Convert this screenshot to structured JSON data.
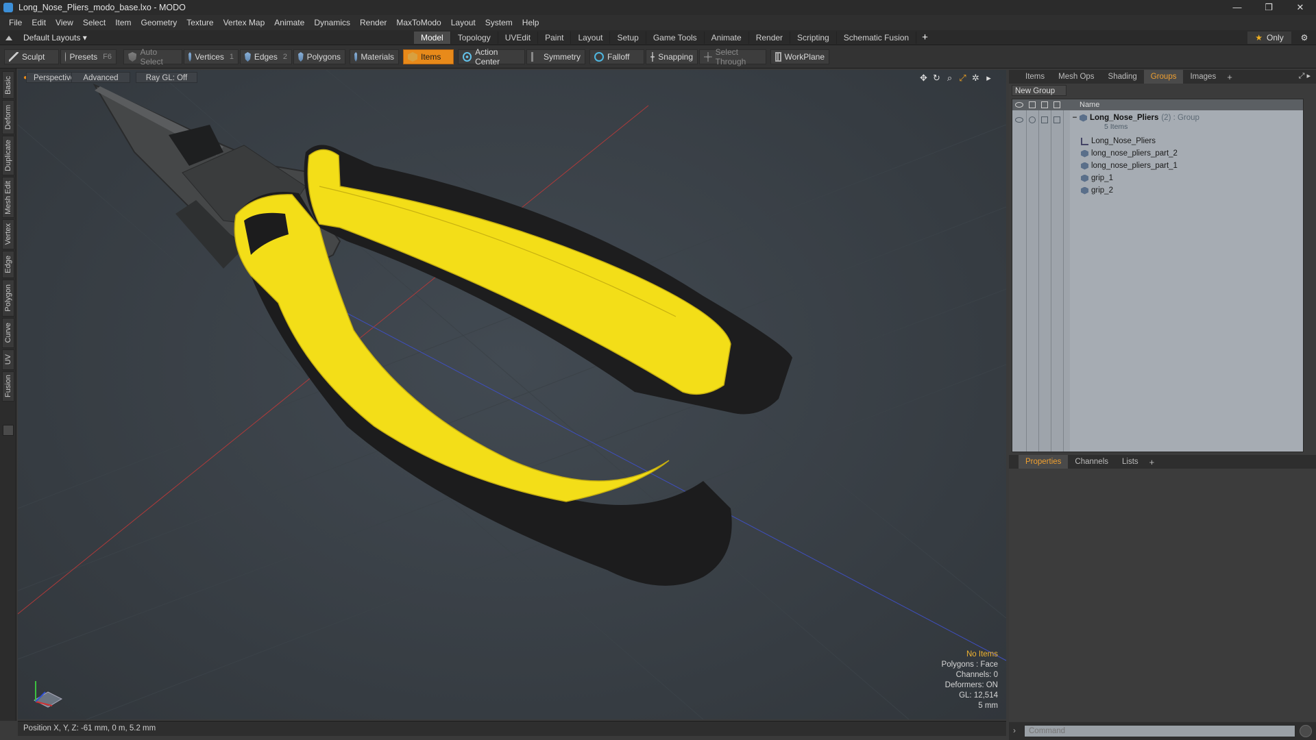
{
  "window": {
    "title": "Long_Nose_Pliers_modo_base.lxo - MODO",
    "controls": [
      "—",
      "❐",
      "✕"
    ]
  },
  "menu": [
    "File",
    "Edit",
    "View",
    "Select",
    "Item",
    "Geometry",
    "Texture",
    "Vertex Map",
    "Animate",
    "Dynamics",
    "Render",
    "MaxToModo",
    "Layout",
    "System",
    "Help"
  ],
  "layout": {
    "label": "Default Layouts ▾",
    "tabs": [
      "Model",
      "Topology",
      "UVEdit",
      "Paint",
      "Layout",
      "Setup",
      "Game Tools",
      "Animate",
      "Render",
      "Scripting",
      "Schematic Fusion"
    ],
    "active_tab": "Model",
    "add": "+",
    "only_label": "Only"
  },
  "toolbar": {
    "sculpt": "Sculpt",
    "presets": "Presets",
    "presets_key": "F6",
    "auto_select": "Auto Select",
    "vertices": "Vertices",
    "vertices_count": "1",
    "edges": "Edges",
    "edges_count": "2",
    "polygons": "Polygons",
    "materials": "Materials",
    "items": "Items",
    "action_center": "Action Center",
    "symmetry": "Symmetry",
    "falloff": "Falloff",
    "snapping": "Snapping",
    "select_through": "Select Through",
    "workplane": "WorkPlane"
  },
  "left_tabs": [
    "Basic",
    "Deform",
    "Duplicate",
    "Mesh Edit",
    "Vertex",
    "Edge",
    "Polygon",
    "Curve",
    "UV",
    "Fusion"
  ],
  "viewport": {
    "view": "Perspective",
    "shading": "Advanced",
    "raygl": "Ray GL: Off",
    "stats": {
      "selection": "No Items",
      "polygons": "Polygons : Face",
      "channels": "Channels: 0",
      "deformers": "Deformers: ON",
      "gl": "GL: 12,514",
      "scale": "5 mm"
    }
  },
  "status": {
    "position": "Position X, Y, Z:  -61 mm, 0 m, 5.2 mm"
  },
  "right_panel": {
    "tabs": [
      "Items",
      "Mesh Ops",
      "Shading",
      "Groups",
      "Images"
    ],
    "active_tab": "Groups",
    "new_group": "New Group",
    "name_header": "Name",
    "group": {
      "name": "Long_Nose_Pliers",
      "suffix": "(2) : Group",
      "count": "5 Items",
      "children": [
        "Long_Nose_Pliers",
        "long_nose_pliers_part_2",
        "long_nose_pliers_part_1",
        "grip_1",
        "grip_2"
      ]
    },
    "prop_tabs": [
      "Properties",
      "Channels",
      "Lists"
    ],
    "active_prop_tab": "Properties",
    "command_placeholder": "Command"
  },
  "colors": {
    "accent": "#e88a1a",
    "grip_yellow": "#f5e21a",
    "grip_black": "#1c1c1c"
  }
}
